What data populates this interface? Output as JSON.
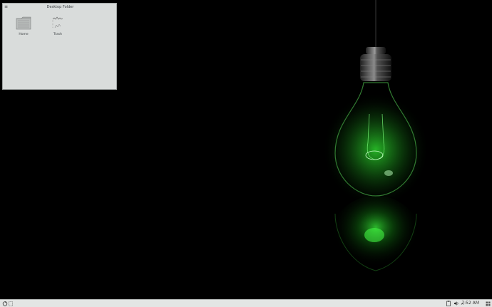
{
  "desktop": {
    "folder_widget": {
      "title": "Desktop Folder",
      "icons": [
        {
          "label": "Home",
          "icon": "home-folder-icon"
        },
        {
          "label": "Trash",
          "icon": "trash-icon"
        }
      ]
    }
  },
  "taskbar": {
    "launcher_icon": "app-launcher-icon",
    "pager_icon": "virtual-desktop-pager-icon",
    "tray_icons": [
      "clipboard-icon",
      "volume-icon"
    ],
    "clock": "7:52 AM",
    "show_desktop_icon": "show-desktop-icon"
  },
  "colors": {
    "accent": "#2bd82b",
    "panel": "#e3e5e4",
    "widget": "#d9dcdb"
  }
}
